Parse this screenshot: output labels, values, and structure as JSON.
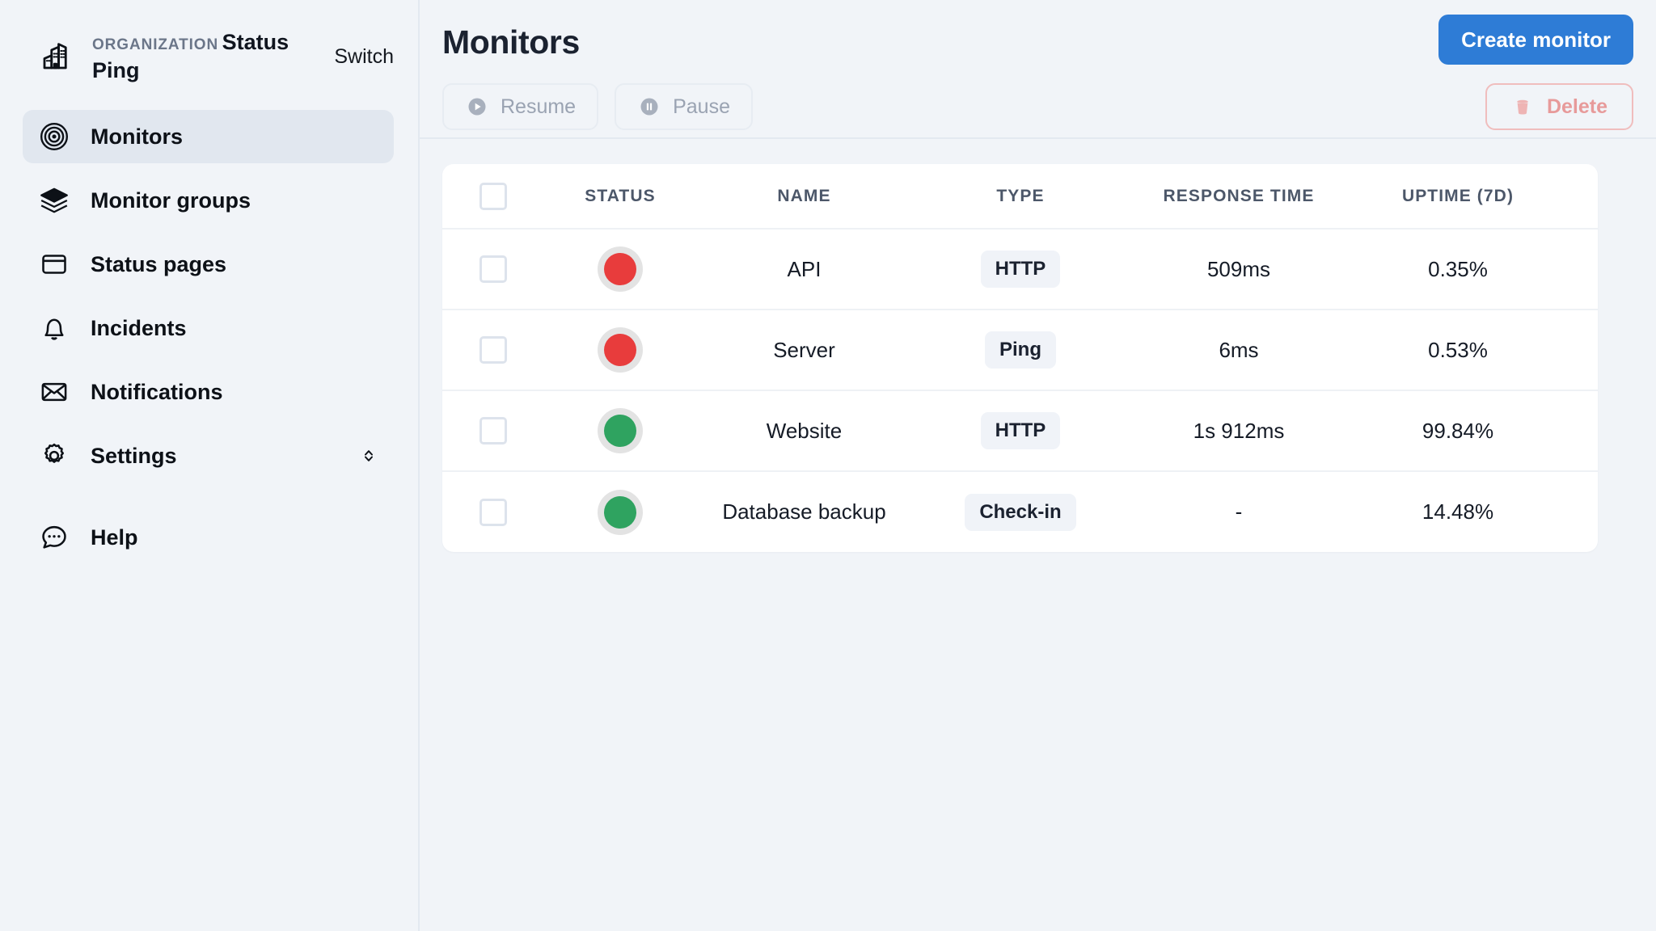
{
  "sidebar": {
    "org": {
      "icon": "buildings-icon",
      "label": "ORGANIZATION",
      "name": "Status Ping",
      "switch_label": "Switch"
    },
    "items": [
      {
        "label": "Monitors",
        "icon": "target-icon",
        "active": true
      },
      {
        "label": "Monitor groups",
        "icon": "layers-icon",
        "active": false
      },
      {
        "label": "Status pages",
        "icon": "window-icon",
        "active": false
      },
      {
        "label": "Incidents",
        "icon": "bell-icon",
        "active": false
      },
      {
        "label": "Notifications",
        "icon": "envelope-icon",
        "active": false
      },
      {
        "label": "Settings",
        "icon": "gear-icon",
        "active": false,
        "chevron": "chevron-up-down-icon"
      },
      {
        "label": "Help",
        "icon": "chat-bubble-icon",
        "active": false
      }
    ]
  },
  "header": {
    "title": "Monitors",
    "create_button": "Create monitor"
  },
  "toolbar": {
    "resume_label": "Resume",
    "pause_label": "Pause",
    "delete_label": "Delete"
  },
  "table": {
    "columns": [
      "STATUS",
      "NAME",
      "TYPE",
      "RESPONSE TIME",
      "UPTIME (7D)"
    ],
    "rows": [
      {
        "status": "down",
        "name": "API",
        "type": "HTTP",
        "response_time": "509ms",
        "uptime": "0.35%",
        "action": null
      },
      {
        "status": "down",
        "name": "Server",
        "type": "Ping",
        "response_time": "6ms",
        "uptime": "0.53%",
        "action": null
      },
      {
        "status": "up",
        "name": "Website",
        "type": "HTTP",
        "response_time": "1s 912ms",
        "uptime": "99.84%",
        "action": null
      },
      {
        "status": "up",
        "name": "Database backup",
        "type": "Check-in",
        "response_time": "-",
        "uptime": "14.48%",
        "action": "stopwatch-icon"
      }
    ]
  },
  "colors": {
    "accent": "#2e7cd6",
    "status_down": "#e83c3c",
    "status_up": "#2fa360",
    "status_ring": "#e3e3e3",
    "danger": "#e79a9a",
    "page_bg": "#f1f4f8",
    "sidebar_active": "#e1e7ef"
  }
}
